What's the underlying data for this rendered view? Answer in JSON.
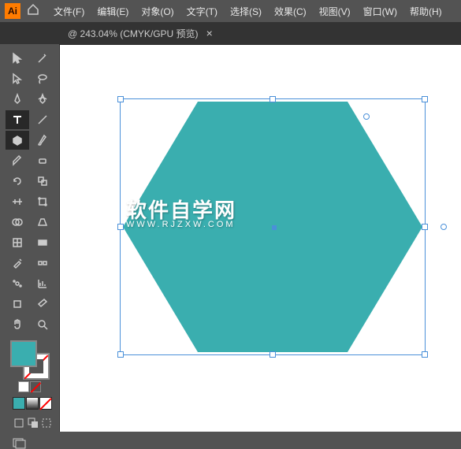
{
  "app": {
    "logo": "Ai"
  },
  "menu": {
    "items": [
      "文件(F)",
      "编辑(E)",
      "对象(O)",
      "文字(T)",
      "选择(S)",
      "效果(C)",
      "视图(V)",
      "窗口(W)",
      "帮助(H)"
    ]
  },
  "tab": {
    "label": "@ 243.04%  (CMYK/GPU 预览)",
    "close": "×"
  },
  "colors": {
    "fill": "#3aaeaf",
    "hexagon": "#3aaeaf",
    "selection": "#4a90d9"
  },
  "watermark": {
    "main": "软件自学网",
    "sub": "WWW.RJZXW.COM"
  },
  "swatches": [
    "#3aaeaf",
    "#8a8a8a",
    "#cccccc"
  ],
  "tools": [
    {
      "name": "selection-tool",
      "icon": "cursor"
    },
    {
      "name": "magic-wand-tool",
      "icon": "wand"
    },
    {
      "name": "direct-selection-tool",
      "icon": "direct"
    },
    {
      "name": "lasso-tool",
      "icon": "lasso"
    },
    {
      "name": "pen-tool",
      "icon": "pen"
    },
    {
      "name": "curvature-tool",
      "icon": "curve"
    },
    {
      "name": "type-tool",
      "icon": "type",
      "selected": true
    },
    {
      "name": "line-tool",
      "icon": "line"
    },
    {
      "name": "polygon-tool",
      "icon": "polygon",
      "selected": true
    },
    {
      "name": "brush-tool",
      "icon": "brush"
    },
    {
      "name": "pencil-tool",
      "icon": "pencil"
    },
    {
      "name": "eraser-tool",
      "icon": "eraser"
    },
    {
      "name": "rotate-tool",
      "icon": "rotate"
    },
    {
      "name": "scale-tool",
      "icon": "scale"
    },
    {
      "name": "width-tool",
      "icon": "width"
    },
    {
      "name": "free-transform-tool",
      "icon": "transform"
    },
    {
      "name": "shape-builder-tool",
      "icon": "shapebuilder"
    },
    {
      "name": "perspective-tool",
      "icon": "perspective"
    },
    {
      "name": "mesh-tool",
      "icon": "mesh"
    },
    {
      "name": "gradient-tool",
      "icon": "gradient"
    },
    {
      "name": "eyedropper-tool",
      "icon": "eyedropper"
    },
    {
      "name": "blend-tool",
      "icon": "blend"
    },
    {
      "name": "symbol-tool",
      "icon": "symbol"
    },
    {
      "name": "graph-tool",
      "icon": "graph"
    },
    {
      "name": "artboard-tool",
      "icon": "artboard"
    },
    {
      "name": "slice-tool",
      "icon": "slice"
    },
    {
      "name": "hand-tool",
      "icon": "hand"
    },
    {
      "name": "zoom-tool",
      "icon": "zoom"
    }
  ]
}
